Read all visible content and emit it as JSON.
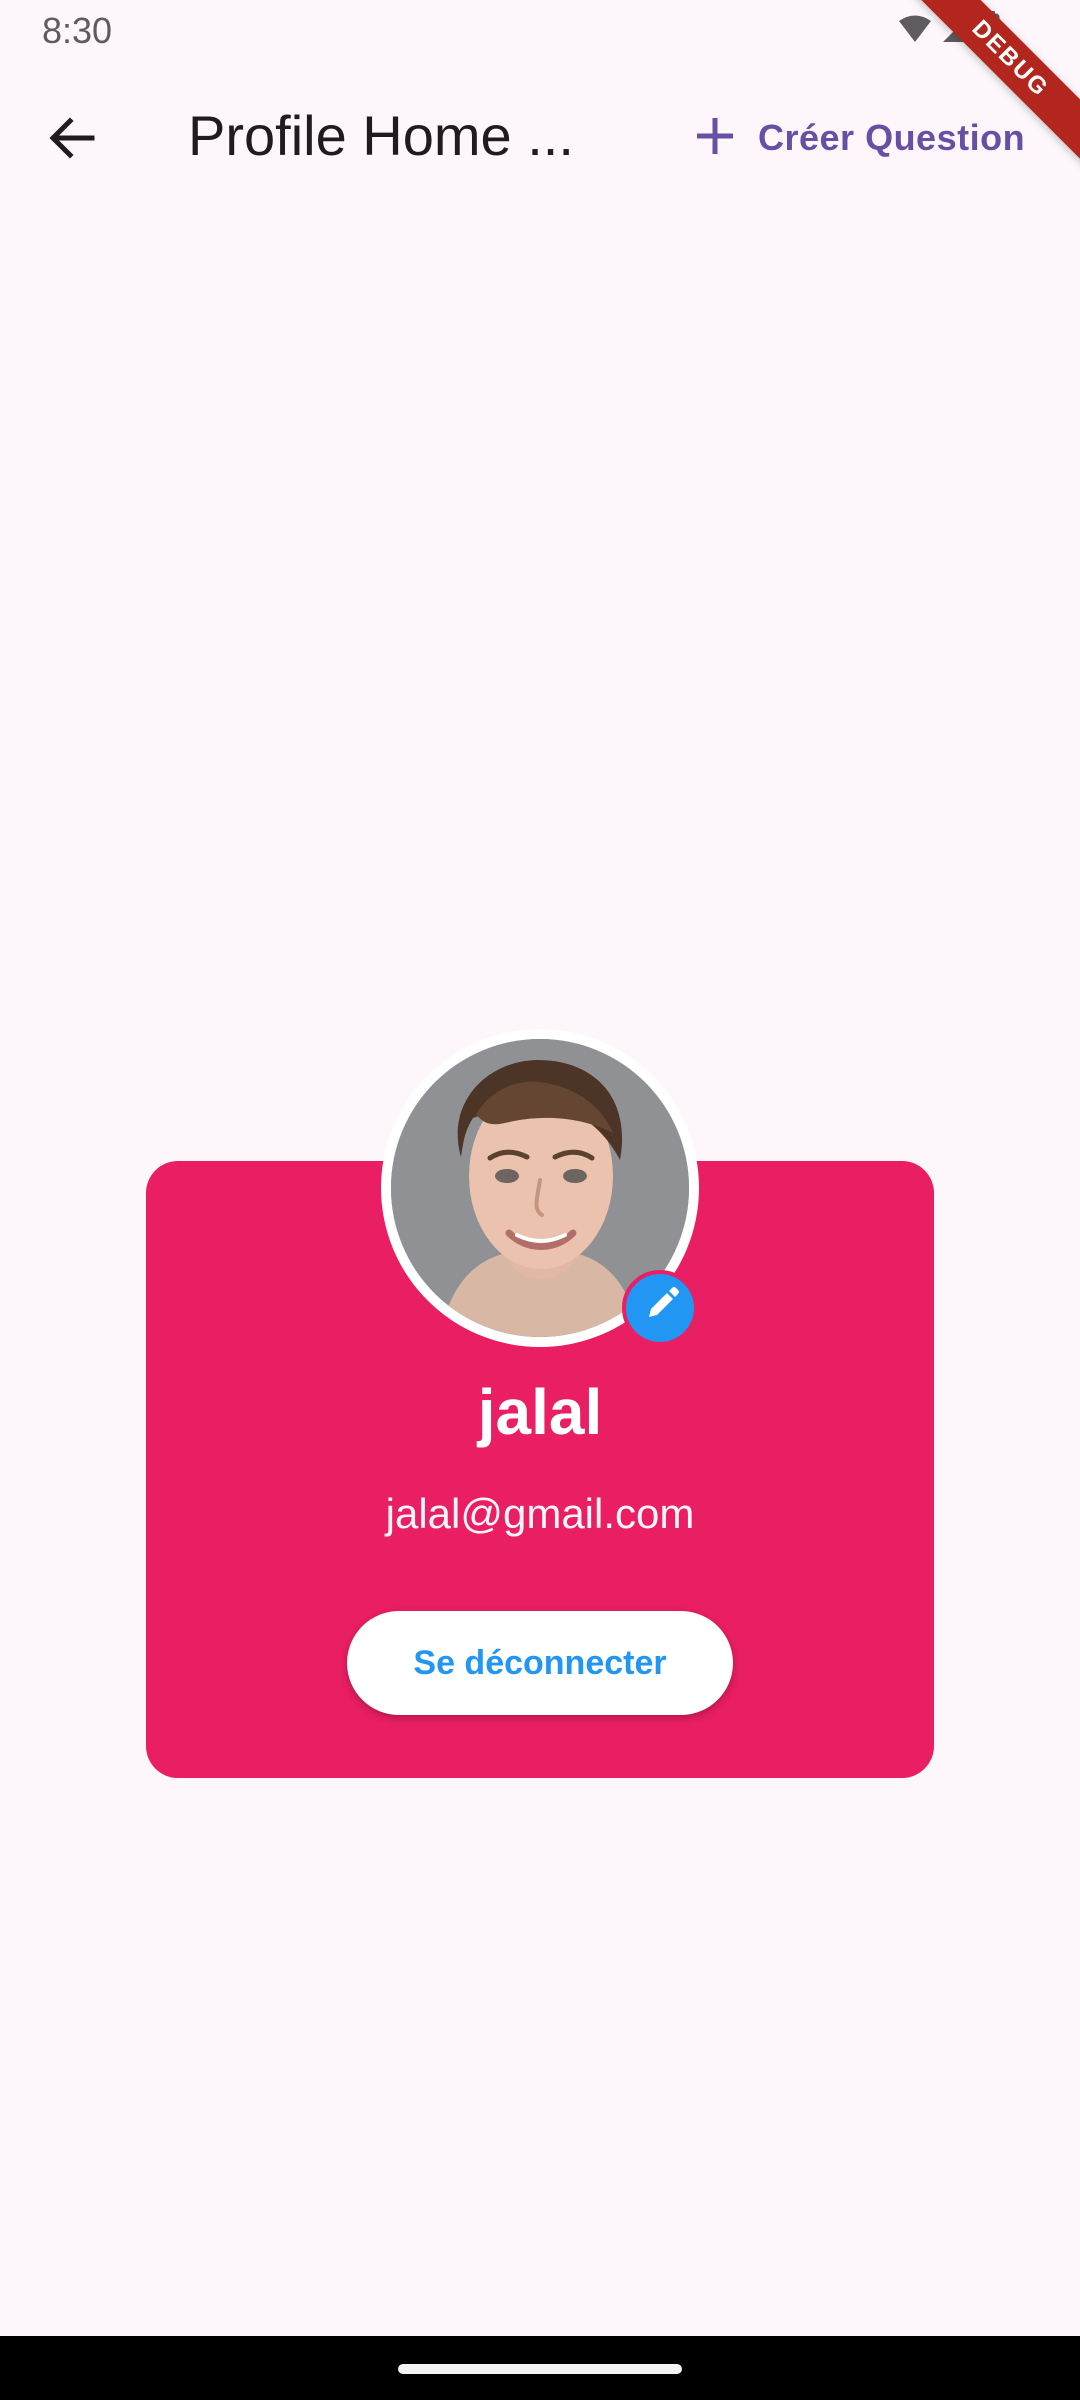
{
  "status_bar": {
    "time": "8:30",
    "icons": [
      "wifi-icon",
      "signal-icon",
      "battery-icon"
    ]
  },
  "debug_banner": {
    "label": "DEBUG"
  },
  "app_bar": {
    "back_icon": "arrow-left-icon",
    "title": "Profile Home ...",
    "create_icon": "plus-icon",
    "create_label": "Créer Question"
  },
  "profile": {
    "avatar_icon": "user-avatar-icon",
    "edit_icon": "pencil-icon",
    "name": "jalal",
    "email": "jalal@gmail.com",
    "logout_label": "Se déconnecter"
  },
  "colors": {
    "background": "#fdf7fc",
    "primary": "#6750a4",
    "card": "#e91e63",
    "accent": "#2196f3",
    "white": "#ffffff"
  }
}
